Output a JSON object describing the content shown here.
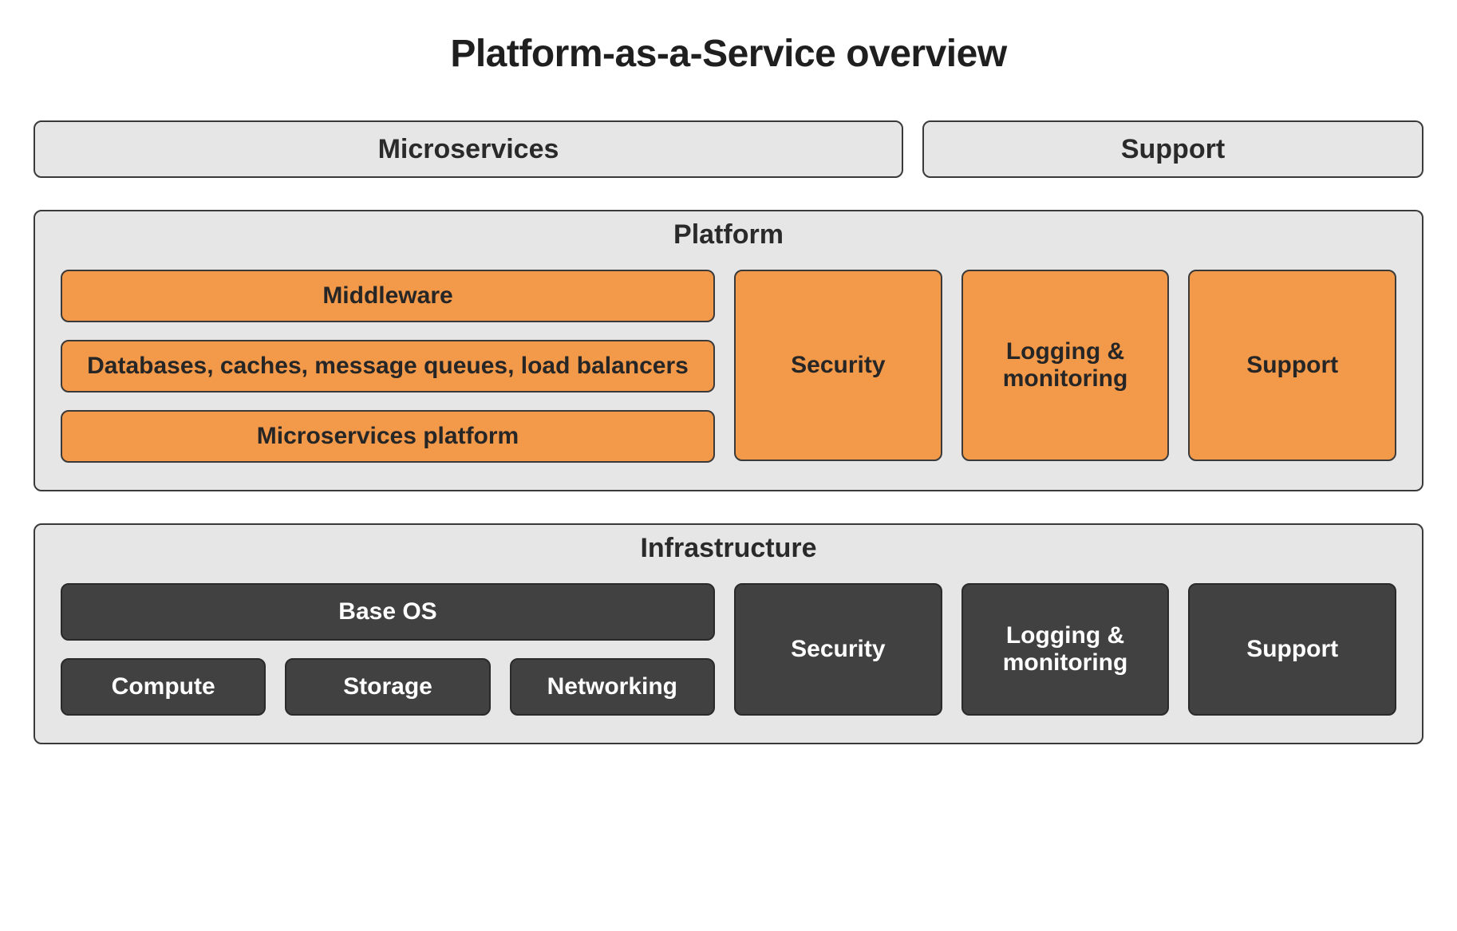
{
  "title": "Platform-as-a-Service overview",
  "top": {
    "microservices": "Microservices",
    "support": "Support"
  },
  "platform": {
    "title": "Platform",
    "stack": {
      "middleware": "Middleware",
      "data_services": "Databases, caches, message queues, load balancers",
      "micro_platform": "Microservices platform"
    },
    "security": "Security",
    "logging": "Logging & monitoring",
    "support": "Support"
  },
  "infrastructure": {
    "title": "Infrastructure",
    "base_os": "Base OS",
    "compute": "Compute",
    "storage": "Storage",
    "networking": "Networking",
    "security": "Security",
    "logging": "Logging & monitoring",
    "support": "Support"
  }
}
